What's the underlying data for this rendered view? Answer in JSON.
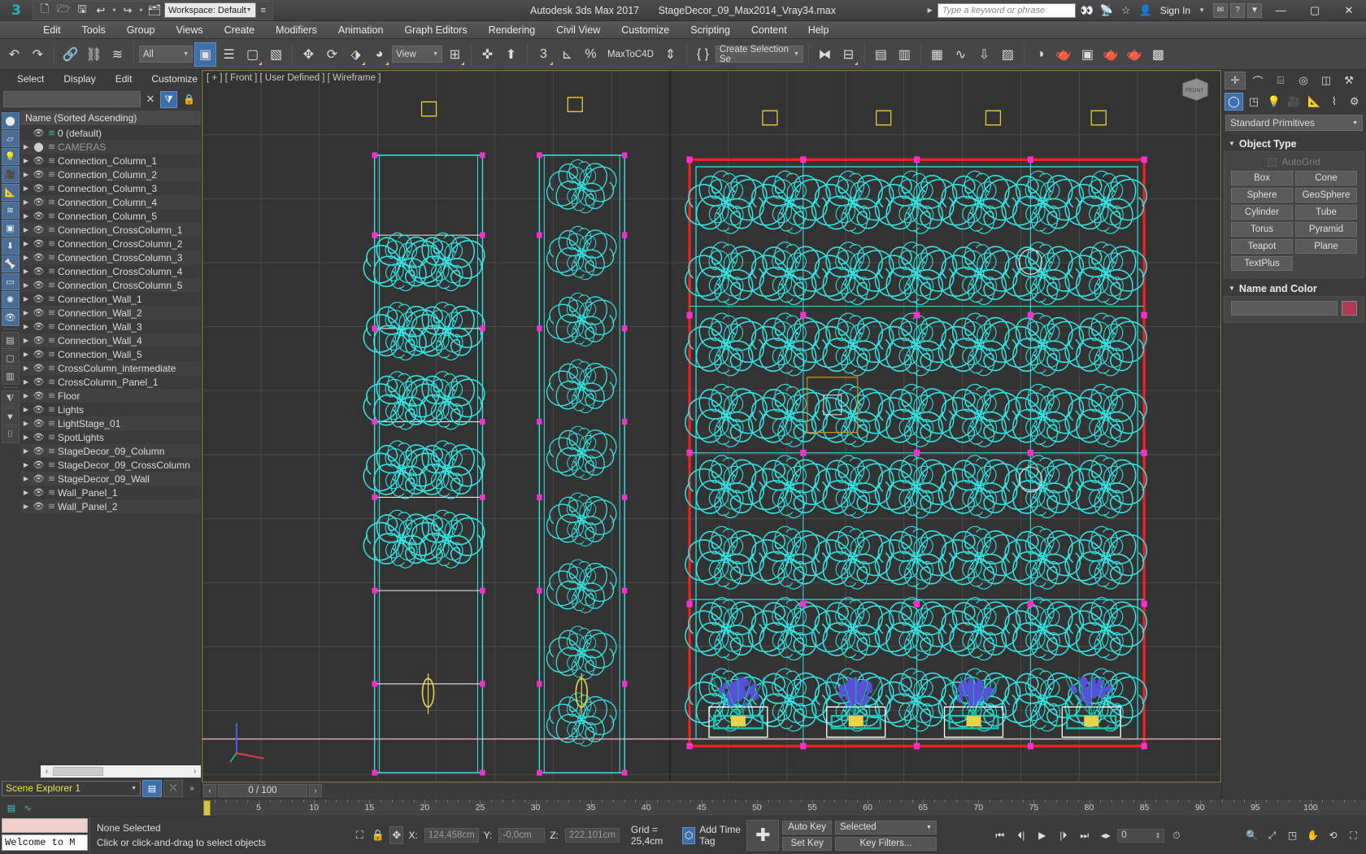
{
  "titlebar": {
    "logo": "3ds-max-logo",
    "quick_access": [
      {
        "name": "new-file",
        "glyph": "🗋"
      },
      {
        "name": "open-file",
        "glyph": "🗁"
      },
      {
        "name": "save-file",
        "glyph": "🖫"
      },
      {
        "name": "undo",
        "glyph": "↩"
      },
      {
        "name": "redo",
        "glyph": "↪"
      },
      {
        "name": "set-project-folder",
        "glyph": "🗂"
      }
    ],
    "workspace_label": "Workspace: Default",
    "app_title": "Autodesk 3ds Max 2017",
    "file_name": "StageDecor_09_Max2014_Vray34.max",
    "search_placeholder": "Type a keyword or phrase",
    "infocenter_icons": [
      "binoculars-icon",
      "satellite-icon",
      "star-icon",
      "user-icon"
    ],
    "sign_in": "Sign In",
    "window_buttons": [
      "minimize",
      "maximize",
      "close"
    ]
  },
  "menubar": {
    "items": [
      "Edit",
      "Tools",
      "Group",
      "Views",
      "Create",
      "Modifiers",
      "Animation",
      "Graph Editors",
      "Rendering",
      "Civil View",
      "Customize",
      "Scripting",
      "Content",
      "Help"
    ]
  },
  "toolbar": {
    "selection_filter": "All",
    "reference_coord": "View",
    "maxtoc4d_label": "MaxToC4D",
    "named_selection_set": "Create Selection Se",
    "buttons": [
      {
        "name": "undo-button",
        "glyph": "↶"
      },
      {
        "name": "redo-button",
        "glyph": "↷"
      },
      {
        "name": "select-and-link-button",
        "glyph": "🔗"
      },
      {
        "name": "unlink-selection-button",
        "glyph": "🔗"
      },
      {
        "name": "bind-to-space-warp-button",
        "glyph": "≈"
      },
      {
        "name": "select-object-button",
        "glyph": "▣"
      },
      {
        "name": "select-by-name-button",
        "glyph": "☰"
      },
      {
        "name": "rectangular-selection-region-button",
        "glyph": "▢"
      },
      {
        "name": "window-crossing-button",
        "glyph": "▧"
      },
      {
        "name": "select-and-move-button",
        "glyph": "✥"
      },
      {
        "name": "select-and-rotate-button",
        "glyph": "⟳"
      },
      {
        "name": "select-and-scale-button",
        "glyph": "⬔"
      },
      {
        "name": "select-and-place-button",
        "glyph": "◕"
      },
      {
        "name": "use-center-flyout-button",
        "glyph": "⊞"
      },
      {
        "name": "select-and-manipulate-button",
        "glyph": "✜"
      },
      {
        "name": "keyboard-shortcut-override-button",
        "glyph": "⬆"
      },
      {
        "name": "snaps-toggle-button",
        "glyph": "3"
      },
      {
        "name": "angle-snap-toggle-button",
        "glyph": "∠"
      },
      {
        "name": "percent-snap-toggle-button",
        "glyph": "%"
      },
      {
        "name": "spinner-snap-toggle-button",
        "glyph": "⇕"
      },
      {
        "name": "edit-named-selection-sets-button",
        "glyph": "{ }"
      },
      {
        "name": "mirror-button",
        "glyph": "⊳⊲"
      },
      {
        "name": "align-button",
        "glyph": "⊟"
      },
      {
        "name": "layer-explorer-button",
        "glyph": "▤"
      },
      {
        "name": "ribbon-toggle-button",
        "glyph": "▦"
      },
      {
        "name": "curve-editor-button",
        "glyph": "∿"
      },
      {
        "name": "schematic-view-button",
        "glyph": "⇩"
      },
      {
        "name": "material-editor-button",
        "glyph": "◑"
      },
      {
        "name": "render-setup-button",
        "glyph": "🫖"
      },
      {
        "name": "rendered-frame-window-button",
        "glyph": "▣"
      },
      {
        "name": "render-production-button",
        "glyph": "🫖"
      },
      {
        "name": "render-iterative-button",
        "glyph": "🫖"
      },
      {
        "name": "activeshade-button",
        "glyph": "🫖"
      },
      {
        "name": "open-asset-tracking-button",
        "glyph": "▥"
      }
    ]
  },
  "scene_explorer": {
    "menu": [
      "Select",
      "Display",
      "Edit",
      "Customize"
    ],
    "search_value": "",
    "column_header": "Name (Sorted Ascending)",
    "panel_name": "Scene Explorer 1",
    "rows": [
      {
        "label": "0 (default)",
        "type": "layer-default",
        "indent": 1
      },
      {
        "label": "CAMERAS",
        "type": "layer-muted",
        "indent": 0
      },
      {
        "label": "Connection_Column_1",
        "type": "layer",
        "indent": 0
      },
      {
        "label": "Connection_Column_2",
        "type": "layer",
        "indent": 0
      },
      {
        "label": "Connection_Column_3",
        "type": "layer",
        "indent": 0
      },
      {
        "label": "Connection_Column_4",
        "type": "layer",
        "indent": 0
      },
      {
        "label": "Connection_Column_5",
        "type": "layer",
        "indent": 0
      },
      {
        "label": "Connection_CrossColumn_1",
        "type": "layer",
        "indent": 0
      },
      {
        "label": "Connection_CrossColumn_2",
        "type": "layer",
        "indent": 0
      },
      {
        "label": "Connection_CrossColumn_3",
        "type": "layer",
        "indent": 0
      },
      {
        "label": "Connection_CrossColumn_4",
        "type": "layer",
        "indent": 0
      },
      {
        "label": "Connection_CrossColumn_5",
        "type": "layer",
        "indent": 0
      },
      {
        "label": "Connection_Wall_1",
        "type": "layer",
        "indent": 0
      },
      {
        "label": "Connection_Wall_2",
        "type": "layer",
        "indent": 0
      },
      {
        "label": "Connection_Wall_3",
        "type": "layer",
        "indent": 0
      },
      {
        "label": "Connection_Wall_4",
        "type": "layer",
        "indent": 0
      },
      {
        "label": "Connection_Wall_5",
        "type": "layer",
        "indent": 0
      },
      {
        "label": "CrossColumn_intermediate",
        "type": "layer",
        "indent": 0
      },
      {
        "label": "CrossColumn_Panel_1",
        "type": "layer",
        "indent": 0
      },
      {
        "label": "Floor",
        "type": "layer",
        "indent": 0
      },
      {
        "label": "Lights",
        "type": "layer",
        "indent": 0
      },
      {
        "label": "LightStage_01",
        "type": "layer",
        "indent": 0
      },
      {
        "label": "SpotLights",
        "type": "layer",
        "indent": 0
      },
      {
        "label": "StageDecor_09_Column",
        "type": "layer",
        "indent": 0
      },
      {
        "label": "StageDecor_09_CrossColumn",
        "type": "layer",
        "indent": 0
      },
      {
        "label": "StageDecor_09_Wall",
        "type": "layer",
        "indent": 0
      },
      {
        "label": "Wall_Panel_1",
        "type": "layer",
        "indent": 0
      },
      {
        "label": "Wall_Panel_2",
        "type": "layer",
        "indent": 0
      }
    ]
  },
  "viewport": {
    "label": "[ + ] [ Front ] [ User Defined ] [ Wireframe ]",
    "viewcube_face": "FRONT",
    "wire_color": "#35e2e2",
    "selection_color": "#ff1f1f",
    "gizmo_color": "#ff2fd0",
    "flower_color": "#5a4fd8"
  },
  "command_panel": {
    "tabs": [
      {
        "name": "create-tab",
        "glyph": "✛",
        "active": true
      },
      {
        "name": "modify-tab",
        "glyph": "⌒"
      },
      {
        "name": "hierarchy-tab",
        "glyph": "⌸"
      },
      {
        "name": "motion-tab",
        "glyph": "◎"
      },
      {
        "name": "display-tab",
        "glyph": "◫"
      },
      {
        "name": "utilities-tab",
        "glyph": "⚒"
      }
    ],
    "subtabs": [
      {
        "name": "geometry-button",
        "glyph": "◯",
        "active": true
      },
      {
        "name": "shapes-button",
        "glyph": "◳"
      },
      {
        "name": "lights-button",
        "glyph": "💡"
      },
      {
        "name": "cameras-button",
        "glyph": "📷"
      },
      {
        "name": "helpers-button",
        "glyph": "📐"
      },
      {
        "name": "space-warps-button",
        "glyph": "⌇"
      },
      {
        "name": "systems-button",
        "glyph": "⚙"
      }
    ],
    "category": "Standard Primitives",
    "object_type_title": "Object Type",
    "autogrid_label": "AutoGrid",
    "object_buttons": [
      "Box",
      "Cone",
      "Sphere",
      "GeoSphere",
      "Cylinder",
      "Tube",
      "Torus",
      "Pyramid",
      "Teapot",
      "Plane",
      "TextPlus"
    ],
    "name_and_color_title": "Name and Color",
    "name_value": "",
    "color_swatch": "#b03a52"
  },
  "timeline": {
    "frame_field": "0 / 100",
    "prev_label": "<",
    "next_label": ">",
    "ruler_labels": [
      "5",
      "10",
      "15",
      "20",
      "25",
      "30",
      "35",
      "40",
      "45",
      "50",
      "55",
      "60",
      "65",
      "70",
      "75",
      "80",
      "85",
      "90",
      "95",
      "100"
    ],
    "slider_frame": 0
  },
  "statusbar": {
    "listener_text": "Welcome to M",
    "selection_status": "None Selected",
    "prompt": "Click or click-and-drag to select objects",
    "lock_icon": "lock-icon",
    "absolute_mode_icon": "absolute-relative-toggle-icon",
    "x_label": "X:",
    "x_value": "124,458cm",
    "y_label": "Y:",
    "y_value": "-0,0cm",
    "z_label": "Z:",
    "z_value": "222,101cm",
    "grid_text": "Grid = 25,4cm",
    "add_time_tag": "Add Time Tag",
    "auto_key": "Auto Key",
    "set_key": "Set Key",
    "key_mode": "Selected",
    "key_filters": "Key Filters...",
    "current_frame": "0",
    "playback_buttons": [
      "go-to-start",
      "previous-frame",
      "play-animation",
      "next-frame",
      "go-to-end"
    ],
    "nav_buttons": [
      "pan-view",
      "zoom-extents",
      "field-of-view",
      "maximize-viewport-toggle",
      "orbit",
      "zoom-region"
    ]
  }
}
